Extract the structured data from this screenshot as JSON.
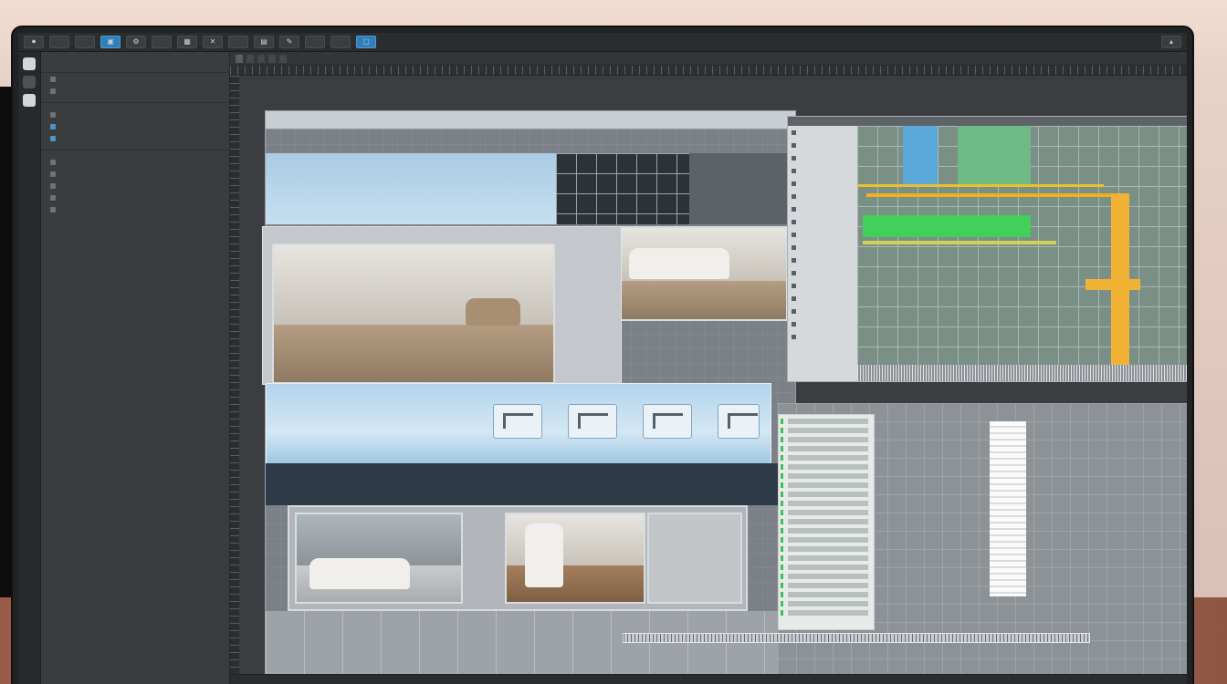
{
  "window": {
    "top_buttons": [
      "",
      "",
      "",
      "",
      "",
      "",
      "",
      "",
      "",
      "",
      "",
      ""
    ],
    "tabs": [
      "",
      "",
      "",
      "",
      ""
    ]
  },
  "left_panel": {
    "items": [
      "",
      "",
      "",
      "",
      "",
      "",
      "",
      "",
      "",
      ""
    ]
  },
  "document": {
    "header_labels": [
      "",
      "",
      "",
      "",
      "",
      "",
      "",
      "",
      "",
      ""
    ]
  },
  "properties_panel": {
    "header": "",
    "rows": [
      "",
      "",
      "",
      "",
      "",
      "",
      "",
      "",
      "",
      "",
      "",
      "",
      "",
      "",
      "",
      "",
      ""
    ]
  },
  "colors": {
    "accent_blue": "#2f7fb8",
    "accent_green": "#3fc05a",
    "accent_yellow": "#f0b21c"
  }
}
